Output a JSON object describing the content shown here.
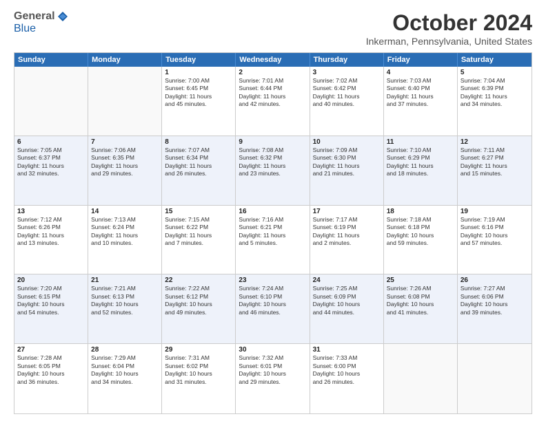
{
  "logo": {
    "general": "General",
    "blue": "Blue"
  },
  "title": "October 2024",
  "location": "Inkerman, Pennsylvania, United States",
  "weekdays": [
    "Sunday",
    "Monday",
    "Tuesday",
    "Wednesday",
    "Thursday",
    "Friday",
    "Saturday"
  ],
  "rows": [
    [
      {
        "day": "",
        "info": ""
      },
      {
        "day": "",
        "info": ""
      },
      {
        "day": "1",
        "info": "Sunrise: 7:00 AM\nSunset: 6:45 PM\nDaylight: 11 hours\nand 45 minutes."
      },
      {
        "day": "2",
        "info": "Sunrise: 7:01 AM\nSunset: 6:44 PM\nDaylight: 11 hours\nand 42 minutes."
      },
      {
        "day": "3",
        "info": "Sunrise: 7:02 AM\nSunset: 6:42 PM\nDaylight: 11 hours\nand 40 minutes."
      },
      {
        "day": "4",
        "info": "Sunrise: 7:03 AM\nSunset: 6:40 PM\nDaylight: 11 hours\nand 37 minutes."
      },
      {
        "day": "5",
        "info": "Sunrise: 7:04 AM\nSunset: 6:39 PM\nDaylight: 11 hours\nand 34 minutes."
      }
    ],
    [
      {
        "day": "6",
        "info": "Sunrise: 7:05 AM\nSunset: 6:37 PM\nDaylight: 11 hours\nand 32 minutes."
      },
      {
        "day": "7",
        "info": "Sunrise: 7:06 AM\nSunset: 6:35 PM\nDaylight: 11 hours\nand 29 minutes."
      },
      {
        "day": "8",
        "info": "Sunrise: 7:07 AM\nSunset: 6:34 PM\nDaylight: 11 hours\nand 26 minutes."
      },
      {
        "day": "9",
        "info": "Sunrise: 7:08 AM\nSunset: 6:32 PM\nDaylight: 11 hours\nand 23 minutes."
      },
      {
        "day": "10",
        "info": "Sunrise: 7:09 AM\nSunset: 6:30 PM\nDaylight: 11 hours\nand 21 minutes."
      },
      {
        "day": "11",
        "info": "Sunrise: 7:10 AM\nSunset: 6:29 PM\nDaylight: 11 hours\nand 18 minutes."
      },
      {
        "day": "12",
        "info": "Sunrise: 7:11 AM\nSunset: 6:27 PM\nDaylight: 11 hours\nand 15 minutes."
      }
    ],
    [
      {
        "day": "13",
        "info": "Sunrise: 7:12 AM\nSunset: 6:26 PM\nDaylight: 11 hours\nand 13 minutes."
      },
      {
        "day": "14",
        "info": "Sunrise: 7:13 AM\nSunset: 6:24 PM\nDaylight: 11 hours\nand 10 minutes."
      },
      {
        "day": "15",
        "info": "Sunrise: 7:15 AM\nSunset: 6:22 PM\nDaylight: 11 hours\nand 7 minutes."
      },
      {
        "day": "16",
        "info": "Sunrise: 7:16 AM\nSunset: 6:21 PM\nDaylight: 11 hours\nand 5 minutes."
      },
      {
        "day": "17",
        "info": "Sunrise: 7:17 AM\nSunset: 6:19 PM\nDaylight: 11 hours\nand 2 minutes."
      },
      {
        "day": "18",
        "info": "Sunrise: 7:18 AM\nSunset: 6:18 PM\nDaylight: 10 hours\nand 59 minutes."
      },
      {
        "day": "19",
        "info": "Sunrise: 7:19 AM\nSunset: 6:16 PM\nDaylight: 10 hours\nand 57 minutes."
      }
    ],
    [
      {
        "day": "20",
        "info": "Sunrise: 7:20 AM\nSunset: 6:15 PM\nDaylight: 10 hours\nand 54 minutes."
      },
      {
        "day": "21",
        "info": "Sunrise: 7:21 AM\nSunset: 6:13 PM\nDaylight: 10 hours\nand 52 minutes."
      },
      {
        "day": "22",
        "info": "Sunrise: 7:22 AM\nSunset: 6:12 PM\nDaylight: 10 hours\nand 49 minutes."
      },
      {
        "day": "23",
        "info": "Sunrise: 7:24 AM\nSunset: 6:10 PM\nDaylight: 10 hours\nand 46 minutes."
      },
      {
        "day": "24",
        "info": "Sunrise: 7:25 AM\nSunset: 6:09 PM\nDaylight: 10 hours\nand 44 minutes."
      },
      {
        "day": "25",
        "info": "Sunrise: 7:26 AM\nSunset: 6:08 PM\nDaylight: 10 hours\nand 41 minutes."
      },
      {
        "day": "26",
        "info": "Sunrise: 7:27 AM\nSunset: 6:06 PM\nDaylight: 10 hours\nand 39 minutes."
      }
    ],
    [
      {
        "day": "27",
        "info": "Sunrise: 7:28 AM\nSunset: 6:05 PM\nDaylight: 10 hours\nand 36 minutes."
      },
      {
        "day": "28",
        "info": "Sunrise: 7:29 AM\nSunset: 6:04 PM\nDaylight: 10 hours\nand 34 minutes."
      },
      {
        "day": "29",
        "info": "Sunrise: 7:31 AM\nSunset: 6:02 PM\nDaylight: 10 hours\nand 31 minutes."
      },
      {
        "day": "30",
        "info": "Sunrise: 7:32 AM\nSunset: 6:01 PM\nDaylight: 10 hours\nand 29 minutes."
      },
      {
        "day": "31",
        "info": "Sunrise: 7:33 AM\nSunset: 6:00 PM\nDaylight: 10 hours\nand 26 minutes."
      },
      {
        "day": "",
        "info": ""
      },
      {
        "day": "",
        "info": ""
      }
    ]
  ]
}
